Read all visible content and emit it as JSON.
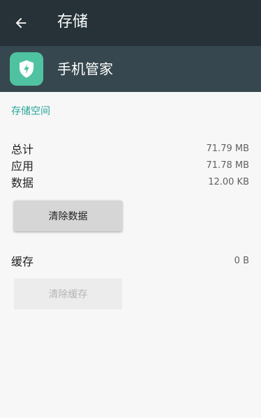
{
  "toolbar": {
    "title": "存储",
    "back_icon": "arrow-back-icon"
  },
  "app": {
    "name": "手机管家",
    "icon": "shield-lightning-icon",
    "icon_color": "#4fc3a1"
  },
  "storage": {
    "section_title": "存储空间",
    "rows": [
      {
        "label": "总计",
        "value": "71.79 MB"
      },
      {
        "label": "应用",
        "value": "71.78 MB"
      },
      {
        "label": "数据",
        "value": "12.00 KB"
      }
    ],
    "clear_data_label": "清除数据"
  },
  "cache": {
    "label": "缓存",
    "value": "0 B",
    "clear_cache_label": "清除缓存",
    "clear_cache_enabled": false
  },
  "colors": {
    "toolbar": "#263238",
    "app_header": "#37474f",
    "accent": "#26a69a",
    "background": "#f7f7f7"
  }
}
